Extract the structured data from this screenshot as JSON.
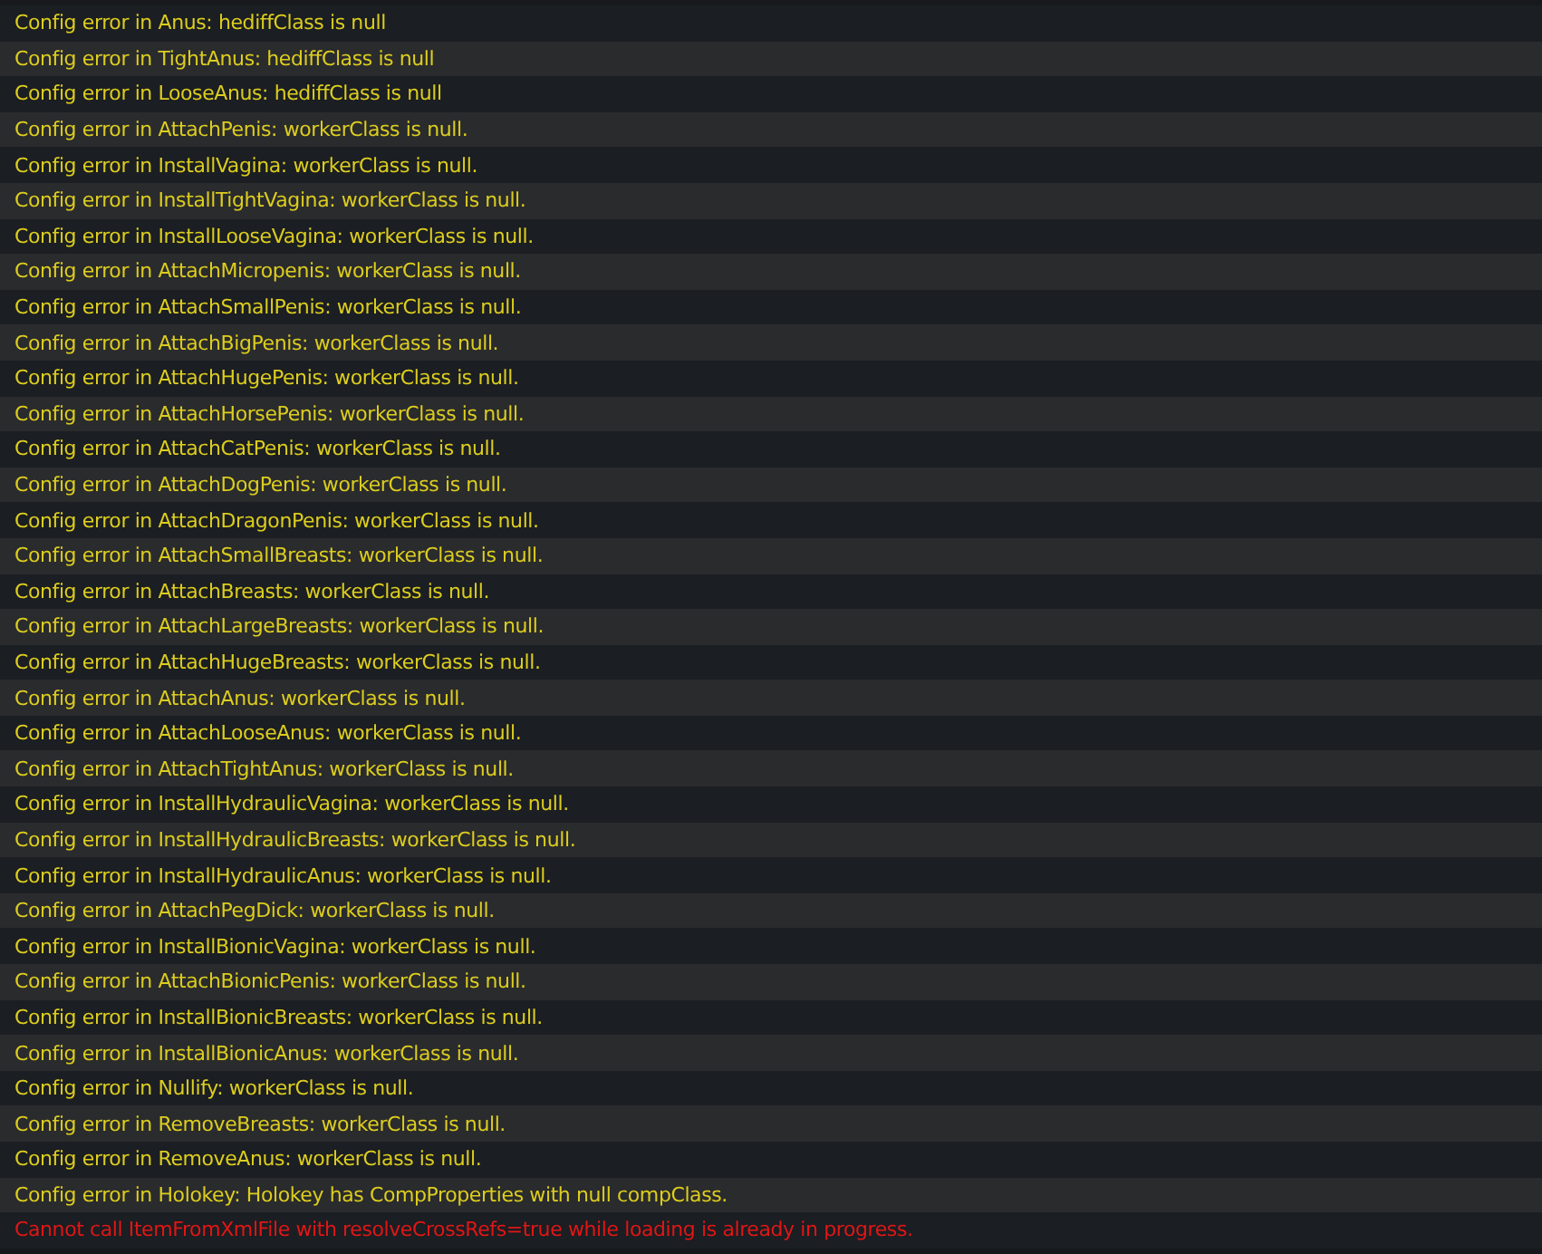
{
  "log_lines": [
    {
      "kind": "warning",
      "text": "Config error in Anus: hediffClass is null"
    },
    {
      "kind": "warning",
      "text": "Config error in TightAnus: hediffClass is null"
    },
    {
      "kind": "warning",
      "text": "Config error in LooseAnus: hediffClass is null"
    },
    {
      "kind": "warning",
      "text": "Config error in AttachPenis: workerClass is null."
    },
    {
      "kind": "warning",
      "text": "Config error in InstallVagina: workerClass is null."
    },
    {
      "kind": "warning",
      "text": "Config error in InstallTightVagina: workerClass is null."
    },
    {
      "kind": "warning",
      "text": "Config error in InstallLooseVagina: workerClass is null."
    },
    {
      "kind": "warning",
      "text": "Config error in AttachMicropenis: workerClass is null."
    },
    {
      "kind": "warning",
      "text": "Config error in AttachSmallPenis: workerClass is null."
    },
    {
      "kind": "warning",
      "text": "Config error in AttachBigPenis: workerClass is null."
    },
    {
      "kind": "warning",
      "text": "Config error in AttachHugePenis: workerClass is null."
    },
    {
      "kind": "warning",
      "text": "Config error in AttachHorsePenis: workerClass is null."
    },
    {
      "kind": "warning",
      "text": "Config error in AttachCatPenis: workerClass is null."
    },
    {
      "kind": "warning",
      "text": "Config error in AttachDogPenis: workerClass is null."
    },
    {
      "kind": "warning",
      "text": "Config error in AttachDragonPenis: workerClass is null."
    },
    {
      "kind": "warning",
      "text": "Config error in AttachSmallBreasts: workerClass is null."
    },
    {
      "kind": "warning",
      "text": "Config error in AttachBreasts: workerClass is null."
    },
    {
      "kind": "warning",
      "text": "Config error in AttachLargeBreasts: workerClass is null."
    },
    {
      "kind": "warning",
      "text": "Config error in AttachHugeBreasts: workerClass is null."
    },
    {
      "kind": "warning",
      "text": "Config error in AttachAnus: workerClass is null."
    },
    {
      "kind": "warning",
      "text": "Config error in AttachLooseAnus: workerClass is null."
    },
    {
      "kind": "warning",
      "text": "Config error in AttachTightAnus: workerClass is null."
    },
    {
      "kind": "warning",
      "text": "Config error in InstallHydraulicVagina: workerClass is null."
    },
    {
      "kind": "warning",
      "text": "Config error in InstallHydraulicBreasts: workerClass is null."
    },
    {
      "kind": "warning",
      "text": "Config error in InstallHydraulicAnus: workerClass is null."
    },
    {
      "kind": "warning",
      "text": "Config error in AttachPegDick: workerClass is null."
    },
    {
      "kind": "warning",
      "text": "Config error in InstallBionicVagina: workerClass is null."
    },
    {
      "kind": "warning",
      "text": "Config error in AttachBionicPenis: workerClass is null."
    },
    {
      "kind": "warning",
      "text": "Config error in InstallBionicBreasts: workerClass is null."
    },
    {
      "kind": "warning",
      "text": "Config error in InstallBionicAnus: workerClass is null."
    },
    {
      "kind": "warning",
      "text": "Config error in Nullify: workerClass is null."
    },
    {
      "kind": "warning",
      "text": "Config error in RemoveBreasts: workerClass is null."
    },
    {
      "kind": "warning",
      "text": "Config error in RemoveAnus: workerClass is null."
    },
    {
      "kind": "warning",
      "text": "Config error in Holokey: Holokey has CompProperties with null compClass."
    },
    {
      "kind": "error",
      "text": "Cannot call ItemFromXmlFile with resolveCrossRefs=true while loading is already in progress."
    }
  ]
}
